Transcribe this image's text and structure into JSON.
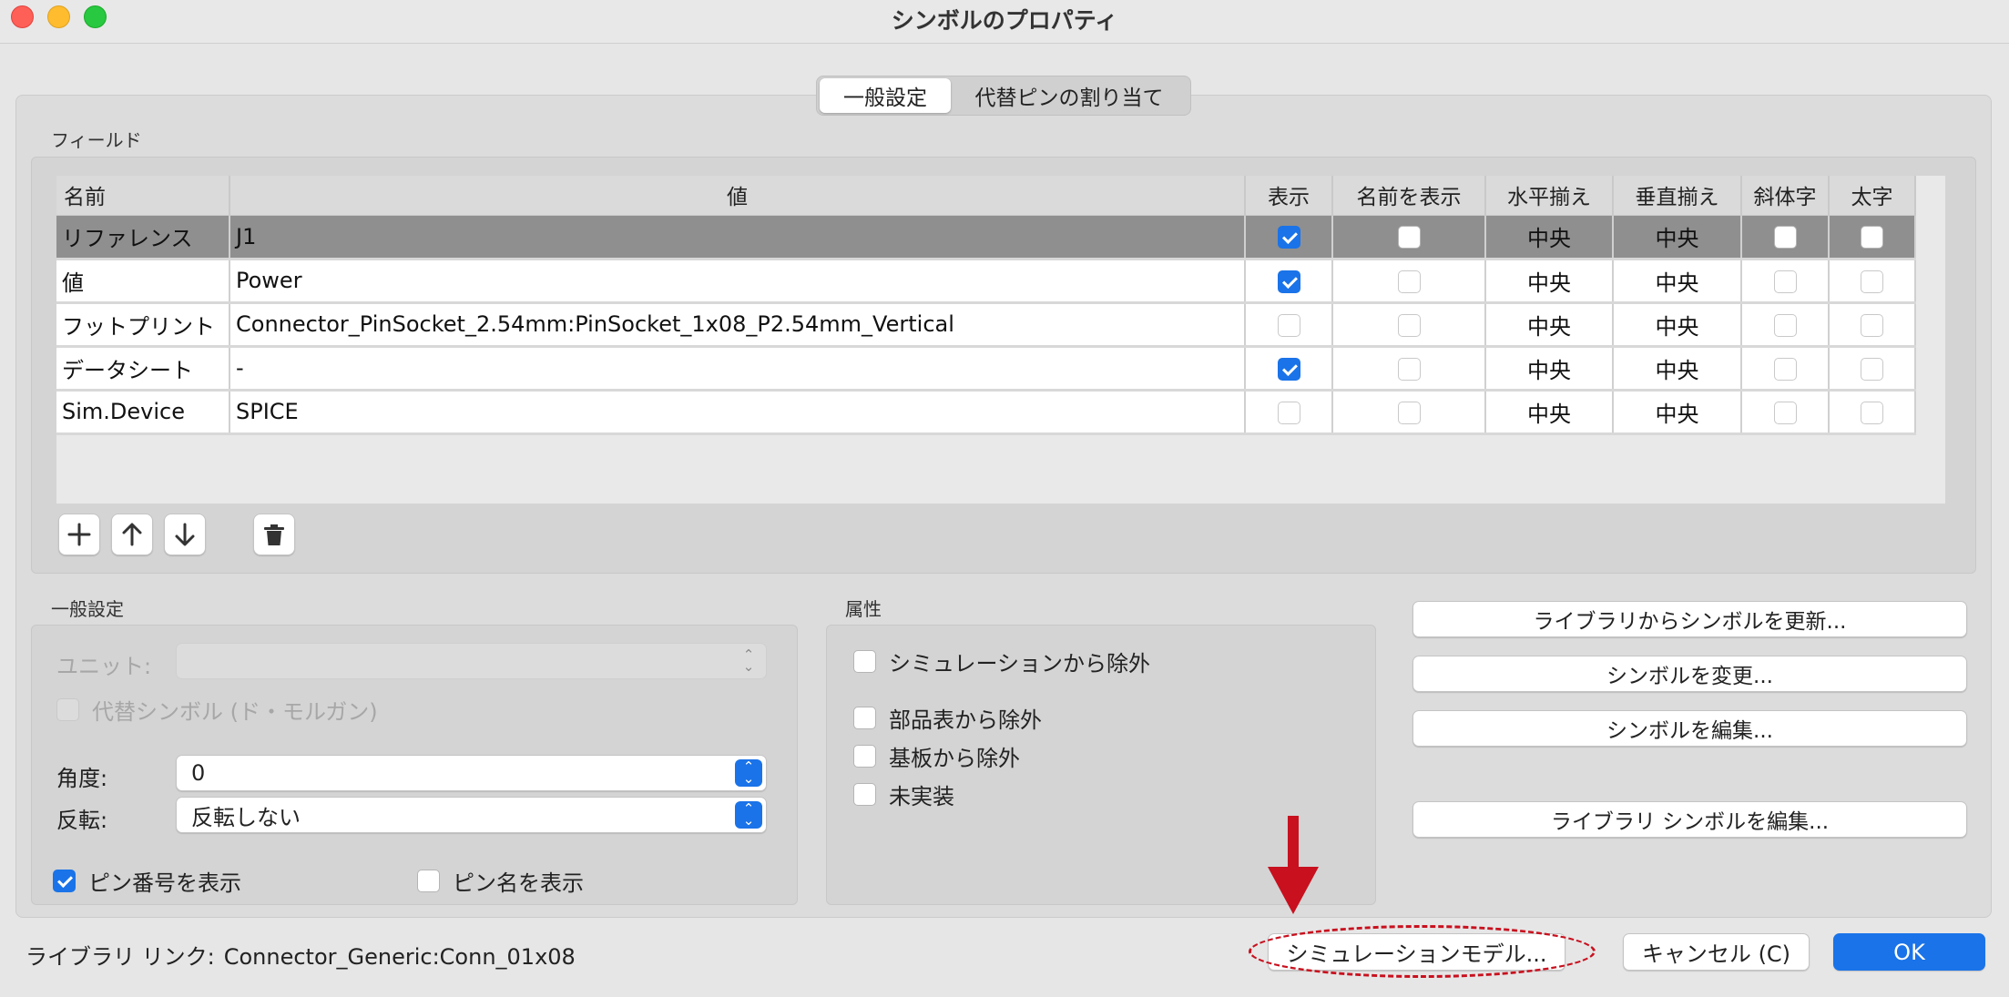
{
  "window": {
    "title": "シンボルのプロパティ"
  },
  "tabs": [
    {
      "label": "一般設定",
      "active": true
    },
    {
      "label": "代替ピンの割り当て",
      "active": false
    }
  ],
  "fields_section": {
    "label": "フィールド",
    "columns": [
      "名前",
      "値",
      "表示",
      "名前を表示",
      "水平揃え",
      "垂直揃え",
      "斜体字",
      "太字"
    ],
    "rows": [
      {
        "name": "リファレンス",
        "value": "J1",
        "show": true,
        "show_name": false,
        "h_align": "中央",
        "v_align": "中央",
        "italic": false,
        "bold": false,
        "selected": true
      },
      {
        "name": "値",
        "value": "Power",
        "show": true,
        "show_name": false,
        "h_align": "中央",
        "v_align": "中央",
        "italic": false,
        "bold": false,
        "selected": false
      },
      {
        "name": "フットプリント",
        "value": "Connector_PinSocket_2.54mm:PinSocket_1x08_P2.54mm_Vertical",
        "show": false,
        "show_name": false,
        "h_align": "中央",
        "v_align": "中央",
        "italic": false,
        "bold": false,
        "selected": false
      },
      {
        "name": "データシート",
        "value": "-",
        "show": true,
        "show_name": false,
        "h_align": "中央",
        "v_align": "中央",
        "italic": false,
        "bold": false,
        "selected": false
      },
      {
        "name": "Sim.Device",
        "value": "SPICE",
        "show": false,
        "show_name": false,
        "h_align": "中央",
        "v_align": "中央",
        "italic": false,
        "bold": false,
        "selected": false
      }
    ],
    "toolbar_icons": [
      "add-icon",
      "move-up-icon",
      "move-down-icon",
      "trash-icon"
    ]
  },
  "general": {
    "label": "一般設定",
    "unit_label": "ユニット:",
    "unit_value": "",
    "alt_symbol_label": "代替シンボル (ド・モルガン)",
    "angle_label": "角度:",
    "angle_value": "0",
    "mirror_label": "反転:",
    "mirror_value": "反転しない",
    "show_pin_numbers_label": "ピン番号を表示",
    "show_pin_numbers": true,
    "show_pin_names_label": "ピン名を表示",
    "show_pin_names": false
  },
  "attributes": {
    "label": "属性",
    "exclude_sim_label": "シミュレーションから除外",
    "exclude_bom_label": "部品表から除外",
    "exclude_board_label": "基板から除外",
    "dnp_label": "未実装"
  },
  "side_buttons": {
    "update_from_library": "ライブラリからシンボルを更新...",
    "change_symbol": "シンボルを変更...",
    "edit_symbol": "シンボルを編集...",
    "edit_library_symbol": "ライブラリ シンボルを編集..."
  },
  "footer": {
    "library_link_label": "ライブラリ リンク:",
    "library_link_value": "Connector_Generic:Conn_01x08",
    "sim_model_button": "シミュレーションモデル...",
    "cancel_button": "キャンセル (C)",
    "ok_button": "OK"
  },
  "colors": {
    "accent": "#1a73e8",
    "annotation": "#c8101e",
    "selected_row": "#8f8f8f"
  }
}
